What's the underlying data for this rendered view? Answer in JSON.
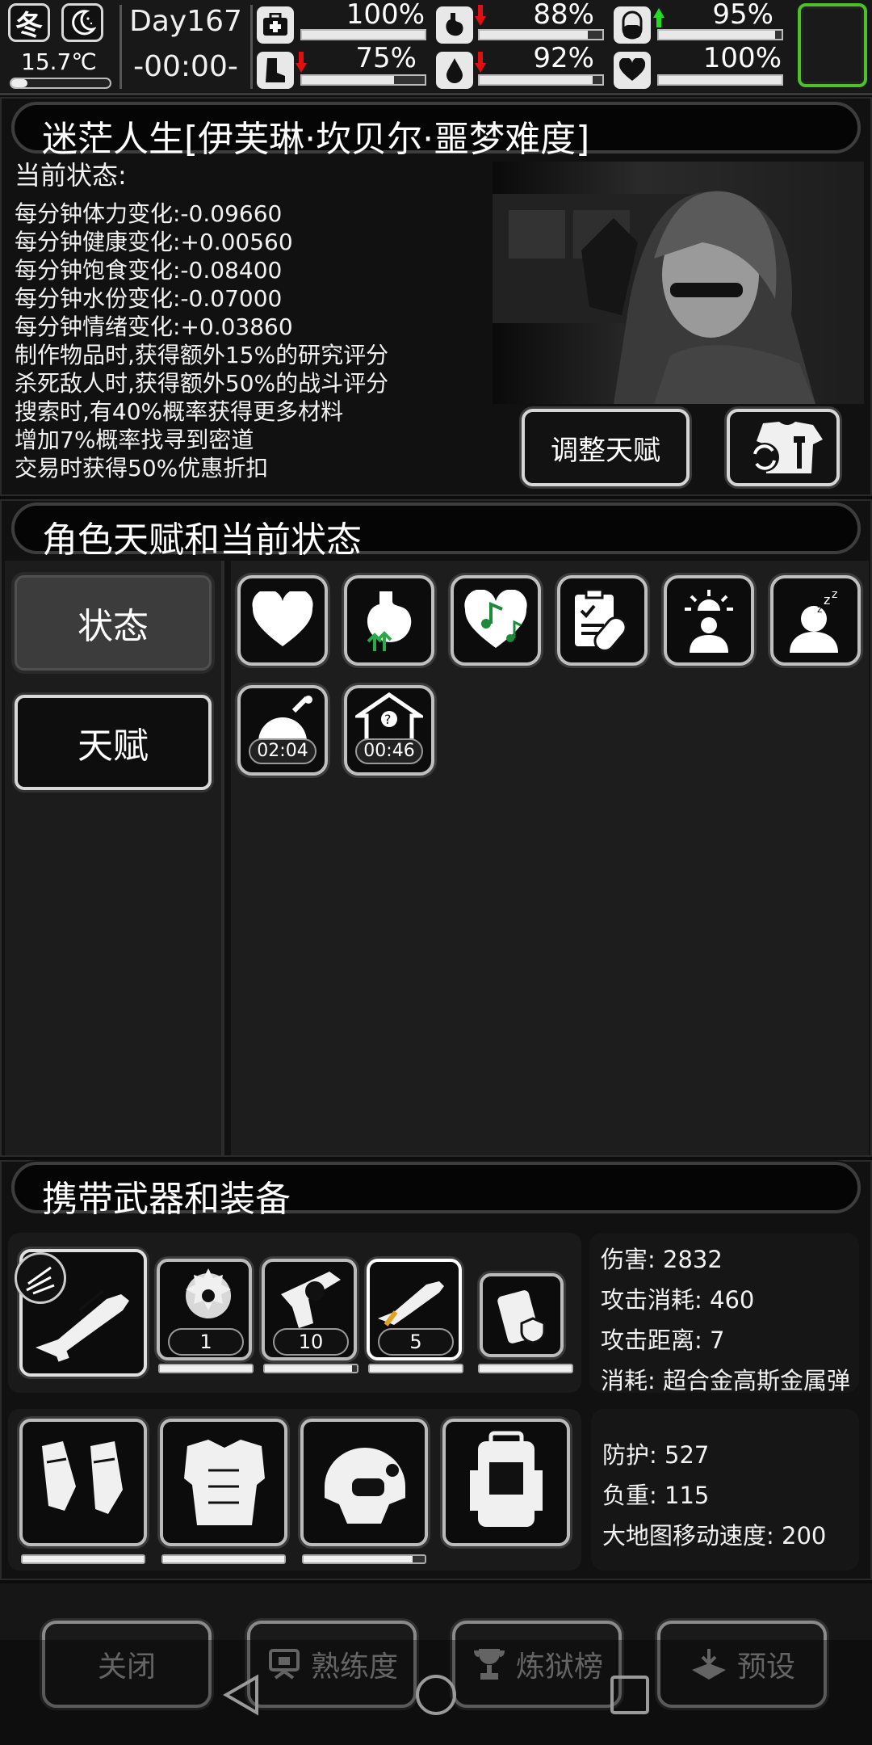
{
  "top": {
    "season": "冬",
    "temperature": "15.7℃",
    "day": "Day167",
    "time": "-00:00-",
    "stats": [
      {
        "name": "health",
        "icon": "medkit-icon",
        "pct": "100%",
        "value": 100,
        "trend": "none"
      },
      {
        "name": "satiety",
        "icon": "stomach-icon",
        "pct": "88%",
        "value": 88,
        "trend": "down"
      },
      {
        "name": "pill",
        "icon": "pill-icon",
        "pct": "95%",
        "value": 95,
        "trend": "up"
      },
      {
        "name": "stamina",
        "icon": "boot-icon",
        "pct": "75%",
        "value": 75,
        "trend": "down"
      },
      {
        "name": "water",
        "icon": "water-drop-icon",
        "pct": "92%",
        "value": 92,
        "trend": "down"
      },
      {
        "name": "mood",
        "icon": "heart-icon",
        "pct": "100%",
        "value": 100,
        "trend": "none"
      }
    ]
  },
  "character": {
    "header": "迷茫人生[伊芙琳·坎贝尔·噩梦难度]",
    "status_title": "当前状态:",
    "lines": [
      "每分钟体力变化:-0.09660",
      "每分钟健康变化:+0.00560",
      "每分钟饱食变化:-0.08400",
      "每分钟水份变化:-0.07000",
      "每分钟情绪变化:+0.03860",
      "制作物品时,获得额外15%的研究评分",
      "杀死敌人时,获得额外50%的战斗评分",
      "搜索时,有40%概率获得更多材料",
      "增加7%概率找寻到密道",
      "交易时获得50%优惠折扣"
    ],
    "adjust_button": "调整天赋"
  },
  "talents": {
    "header": "角色天赋和当前状态",
    "tab_status": "状态",
    "tab_talent": "天赋",
    "icons": [
      "heart-icon",
      "stomach-arrows-icon",
      "music-heart-icon",
      "clipboard-pill-icon",
      "alarm-person-icon",
      "sleep-person-icon",
      "food-timer-icon",
      "shelter-question-icon"
    ],
    "timers": [
      "02:04",
      "00:46"
    ]
  },
  "equipment": {
    "header": "携带武器和装备",
    "weapon_counts": [
      "1",
      "10",
      "5"
    ],
    "weapon_bars": [
      1.0,
      0.95,
      1.0,
      1.0,
      1.0
    ],
    "armor_bars": [
      1.0,
      1.0,
      0.9,
      0
    ],
    "weapon_info": {
      "damage": "伤害: 2832",
      "attack_cost": "攻击消耗: 460",
      "attack_range": "攻击距离: 7",
      "ammo": "消耗: 超合金高斯金属弹"
    },
    "armor_info": {
      "defense": "防护: 527",
      "weight": "负重: 115",
      "map_speed": "大地图移动速度: 200"
    }
  },
  "bottom": {
    "close": "关闭",
    "proficiency": "熟练度",
    "ranking": "炼狱榜",
    "preset": "预设"
  }
}
